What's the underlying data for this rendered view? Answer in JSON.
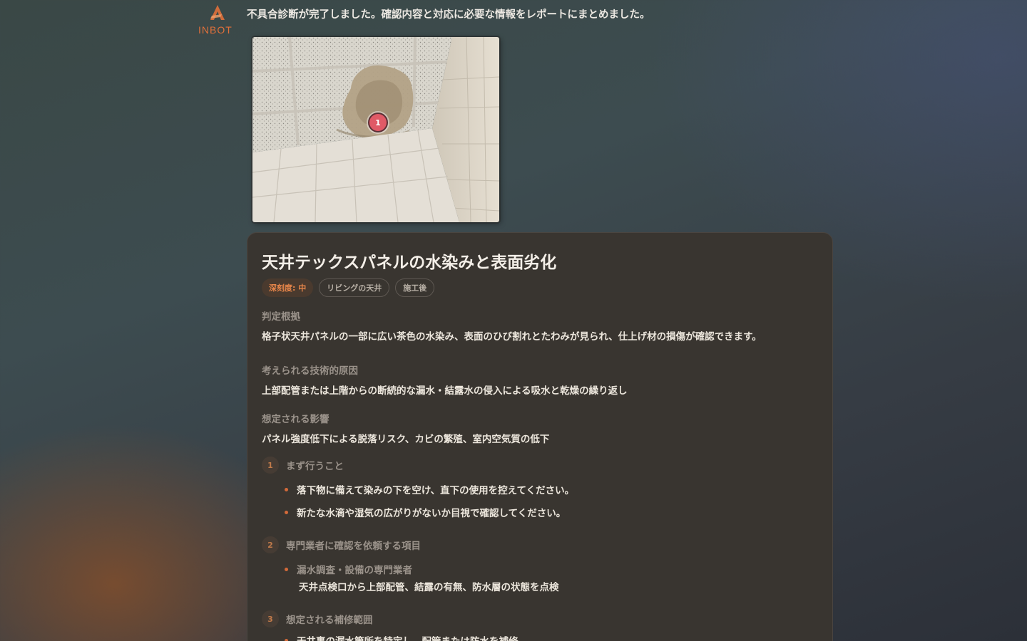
{
  "app": {
    "logo_text": "INBOT",
    "accent_color": "#e0703a"
  },
  "message": {
    "intro": "不具合診断が完了しました。確認内容と対応に必要な情報をレポートにまとめました。"
  },
  "photo": {
    "marker_label": "1"
  },
  "report": {
    "title": "天井テックスパネルの水染みと表面劣化",
    "badges": {
      "severity": "深刻度: 中",
      "location": "リビングの天井",
      "phase": "施工後"
    },
    "basis_label": "判定根拠",
    "basis_text": "格子状天井パネルの一部に広い茶色の水染み、表面のひび割れとたわみが見られ、仕上げ材の損傷が確認できます。",
    "cause_label": "考えられる技術的原因",
    "cause_text": "上部配管または上階からの断続的な漏水・結露水の侵入による吸水と乾燥の繰り返し",
    "impact_label": "想定される影響",
    "impact_text": "パネル強度低下による脱落リスク、カビの繁殖、室内空気質の低下",
    "steps": [
      {
        "num": "1",
        "title": "まず行うこと",
        "bullets": [
          "落下物に備えて染みの下を空け、直下の使用を控えてください。",
          "新たな水滴や湿気の広がりがないか目視で確認してください。"
        ]
      },
      {
        "num": "2",
        "title": "専門業者に確認を依頼する項目",
        "expert_name": "漏水調査・設備の専門業者",
        "expert_detail": "天井点検口から上部配管、結露の有無、防水層の状態を点検"
      },
      {
        "num": "3",
        "title": "想定される補修範囲",
        "bullets": [
          "天井裏の漏水箇所を特定し、配管または防水を補修"
        ]
      }
    ]
  }
}
